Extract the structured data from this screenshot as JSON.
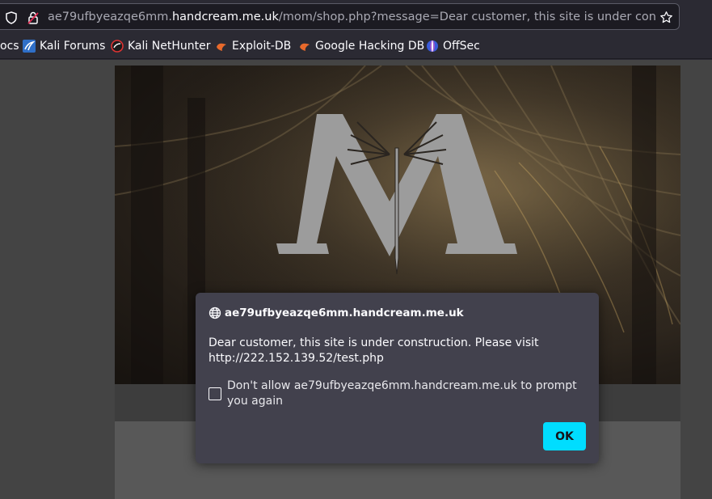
{
  "urlbar": {
    "url_prefix": "ae79ufbyeazqe6mm.",
    "url_host": "handcream.me.uk",
    "url_path": "/mom/shop.php?message=Dear customer, this site is under constructio",
    "icons": [
      "shield-icon",
      "insecure-lock-icon",
      "bookmark-star-icon"
    ]
  },
  "bookmarks": {
    "items": [
      {
        "label": "ocs",
        "icon": "none"
      },
      {
        "label": "Kali Forums",
        "icon": "kali-forums-icon"
      },
      {
        "label": "Kali NetHunter",
        "icon": "kali-nethunter-icon"
      },
      {
        "label": "Exploit-DB",
        "icon": "exploit-db-icon"
      },
      {
        "label": "Google Hacking DB",
        "icon": "ghdb-icon"
      },
      {
        "label": "OffSec",
        "icon": "offsec-icon"
      }
    ]
  },
  "dialog": {
    "origin": "ae79ufbyeazqe6mm.handcream.me.uk",
    "message_line1": "Dear customer, this site is under construction. Please visit",
    "message_line2": "http://222.152.139.52/test.php",
    "checkbox_label": "Don't allow ae79ufbyeazqe6mm.handcream.me.uk to prompt you again",
    "checkbox_checked": false,
    "ok_label": "OK"
  },
  "colors": {
    "accent": "#00ddff",
    "dialog_bg": "#42414d",
    "toolbar_bg": "#2b2a33"
  }
}
